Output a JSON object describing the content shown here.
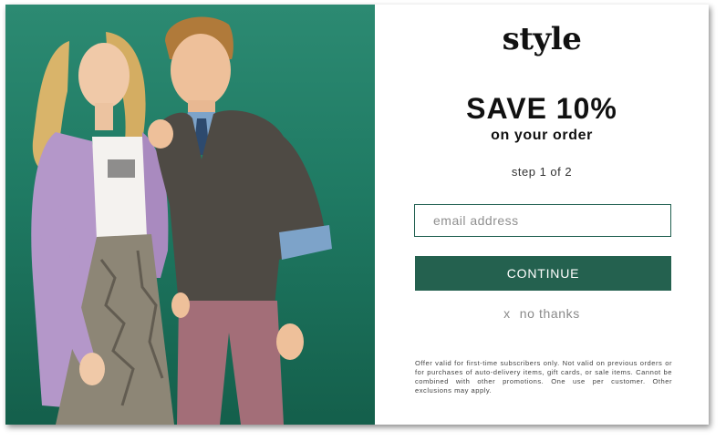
{
  "photo": {
    "description_icon": "models-photo",
    "background_color": "#1f7a63"
  },
  "brand": {
    "logo_text": "style"
  },
  "offer": {
    "headline": "SAVE 10%",
    "subheadline": "on your order",
    "step": "step 1 of 2"
  },
  "form": {
    "email_placeholder": "email address",
    "email_value": "",
    "continue_label": "CONTINUE",
    "dismiss_icon": "x",
    "dismiss_label": "no thanks"
  },
  "disclaimer": "Offer valid for first-time subscribers only. Not valid on previous orders or for purchases of auto-delivery items, gift cards, or sale items. Cannot be combined with other promotions. One use per customer. Other exclusions may apply.",
  "colors": {
    "accent": "#24614f",
    "panel_background": "#ffffff"
  }
}
